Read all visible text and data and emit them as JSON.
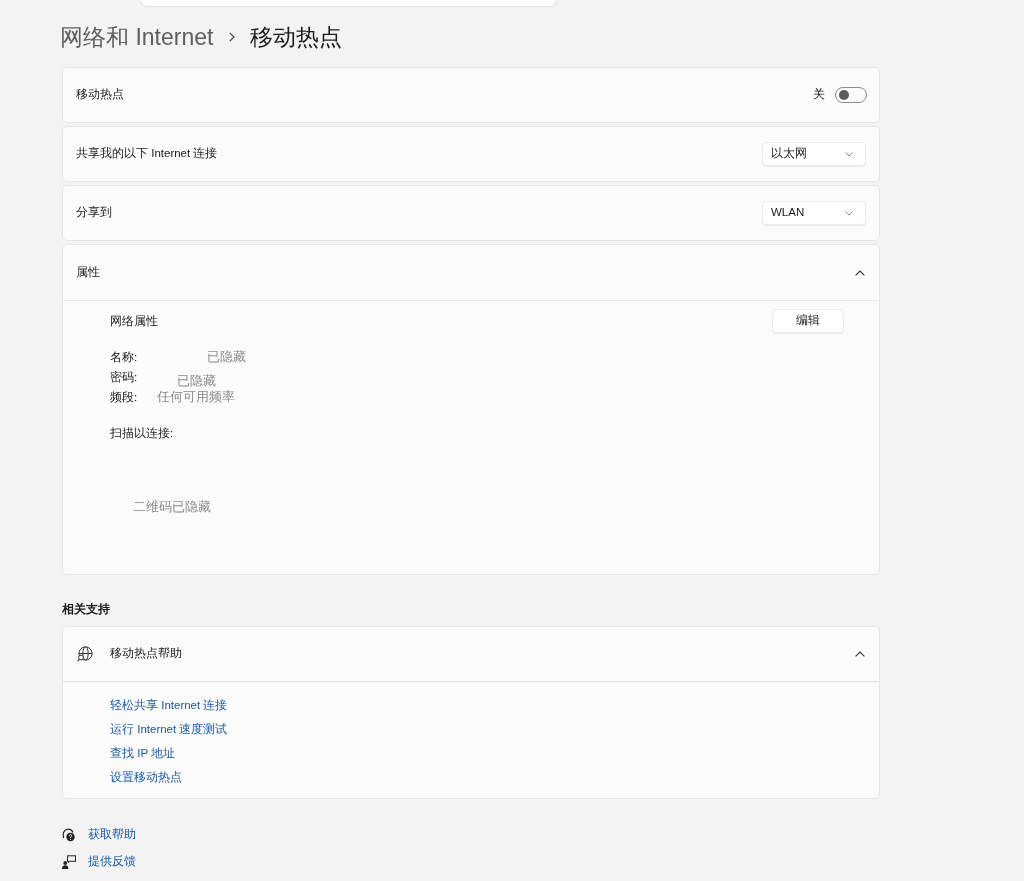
{
  "breadcrumb": {
    "parent": "网络和 Internet",
    "current": "移动热点"
  },
  "settings": [
    {
      "kind": "toggle",
      "label": "移动热点",
      "state_label": "关",
      "on": false
    },
    {
      "kind": "dropdown",
      "label": "共享我的以下 Internet 连接",
      "value": "以太网"
    },
    {
      "kind": "dropdown",
      "label": "分享到",
      "value": "WLAN"
    },
    {
      "kind": "expander",
      "label": "属性",
      "expanded": true,
      "content": {
        "title": "网络属性",
        "edit_button": "编辑",
        "fields": [
          {
            "label": "名称:",
            "value": "已隐藏"
          },
          {
            "label": "密码:",
            "value": "已隐藏"
          },
          {
            "label": "频段:",
            "value": "任何可用频率"
          }
        ],
        "scan_label": "扫描以连接:",
        "qr_placeholder": "二维码已隐藏"
      }
    }
  ],
  "related_support": {
    "heading": "相关支持",
    "help": {
      "title": "移动热点帮助",
      "expanded": true,
      "links": [
        "轻松共享 Internet 连接",
        "运行 Internet 速度测试",
        "查找 IP 地址",
        "设置移动热点"
      ]
    }
  },
  "footer_links": [
    {
      "kind": "help",
      "label": "获取帮助"
    },
    {
      "kind": "feedback",
      "label": "提供反馈"
    }
  ]
}
